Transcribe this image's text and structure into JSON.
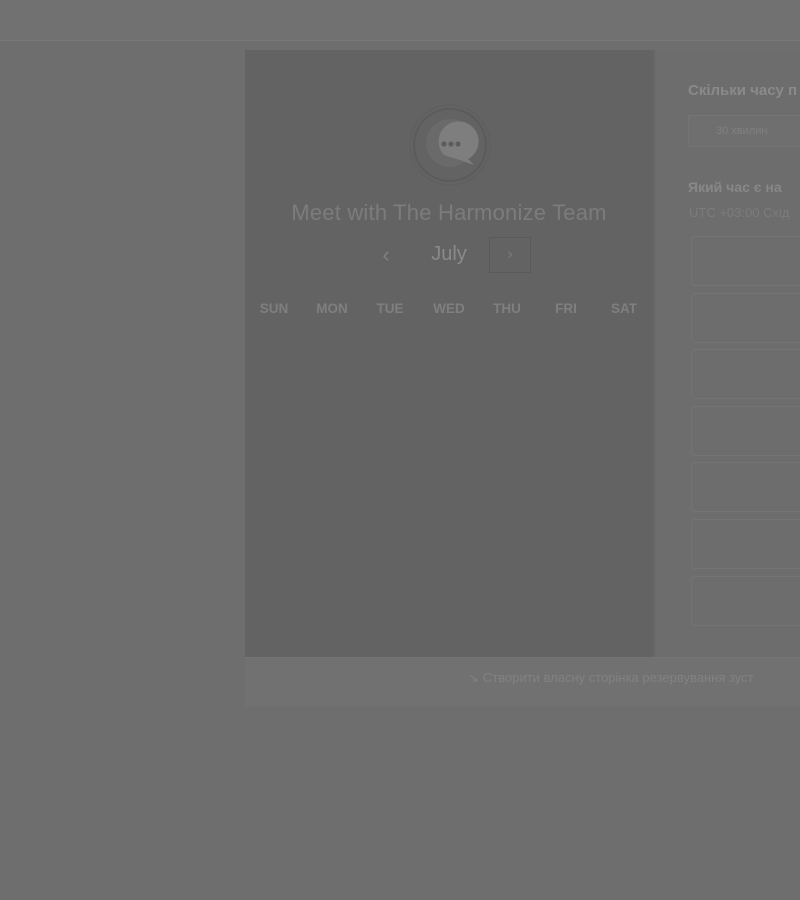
{
  "left": {
    "title": "Meet with The Harmonize Team",
    "month": "July",
    "prev_label": "‹",
    "next_label": "›",
    "weekdays": [
      "SUN",
      "MON",
      "TUE",
      "WED",
      "THU",
      "FRI",
      "SAT"
    ],
    "logo_icon": "chat-bubble-icon"
  },
  "right": {
    "duration_title": "Скільки часу п",
    "duration_option": "30 хвилин",
    "time_title": "Який час є на",
    "timezone": "UTC +03:00 Схід"
  },
  "footer": {
    "link": "Створити власну сторінка резервування зуст",
    "link_icon": "↘"
  },
  "colors": {
    "overlay": "#6e6e6e",
    "panel": "#636363"
  }
}
